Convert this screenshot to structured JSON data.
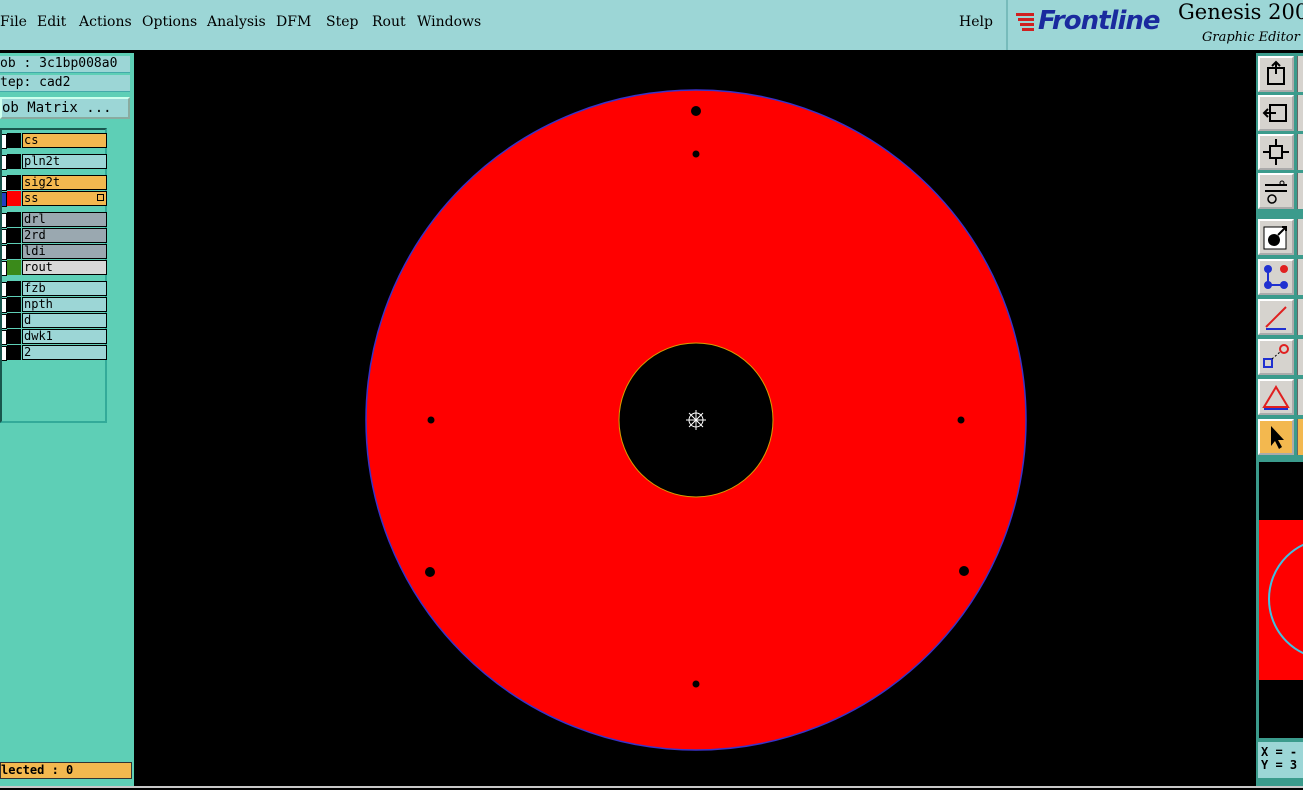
{
  "menu": {
    "items": [
      "File",
      "Edit",
      "Actions",
      "Options",
      "Analysis",
      "DFM",
      "Step",
      "Rout",
      "Windows"
    ],
    "help": "Help"
  },
  "logo": {
    "brand": "Frontline",
    "title": "Genesis 200",
    "subtitle": "Graphic Editor"
  },
  "job": {
    "job_label": "ob : 3c1bp008a0",
    "step_label": "tep: cad2",
    "matrix_button": "ob Matrix ..."
  },
  "layers": [
    {
      "name": "cs",
      "bg": "#f3b84f",
      "swatch": "#000000"
    },
    {
      "name": "pln2t",
      "bg": "#9cd6d6",
      "swatch": "#000000"
    },
    {
      "name": "sig2t",
      "bg": "#f3b84f",
      "swatch": "#000000"
    },
    {
      "name": "ss",
      "bg": "#f3b84f",
      "swatch": "#ff0000"
    },
    {
      "name": "drl",
      "bg": "#9aa8b0",
      "swatch": "#000000"
    },
    {
      "name": "2rd",
      "bg": "#9aa8b0",
      "swatch": "#000000"
    },
    {
      "name": "ldi",
      "bg": "#9aa8b0",
      "swatch": "#000000"
    },
    {
      "name": "rout",
      "bg": "#d8d8d8",
      "swatch": "#3a8a1a"
    },
    {
      "name": "fzb",
      "bg": "#9cd6d6",
      "swatch": "#000000"
    },
    {
      "name": "npth",
      "bg": "#9cd6d6",
      "swatch": "#000000"
    },
    {
      "name": "d",
      "bg": "#9cd6d6",
      "swatch": "#000000"
    },
    {
      "name": "dwk1",
      "bg": "#9cd6d6",
      "swatch": "#000000"
    },
    {
      "name": "2",
      "bg": "#9cd6d6",
      "swatch": "#000000"
    }
  ],
  "status": {
    "selected": "lected : 0"
  },
  "coords": {
    "x_label": "X = -",
    "y_label": "Y = 3"
  },
  "toolbar": {
    "buttons": [
      "open-job-icon",
      "close-icon",
      "zoom-fit-icon",
      "tools-icon",
      "add-feature-icon",
      "connect-icon",
      "line-icon",
      "snap-icon",
      "measure-icon",
      "select-pointer-icon"
    ]
  },
  "colors": {
    "board_fill": "#ff0000",
    "board_outline": "#3a32c8",
    "hole_outline": "#d8a000",
    "panel_bg": "#5ecfb6",
    "menu_bg": "#9cd6d6",
    "highlight": "#f3b84f"
  }
}
